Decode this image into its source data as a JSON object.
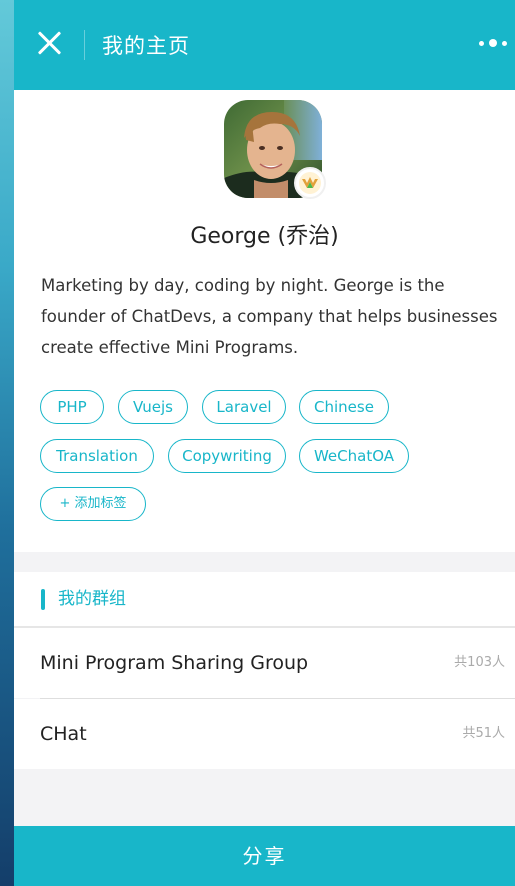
{
  "header": {
    "title": "我的主页",
    "close_icon": "close-icon",
    "more_icon": "more-dots-icon"
  },
  "profile": {
    "avatar_icon": "user-avatar",
    "badge_icon": "wechat-badge-icon",
    "name": "George (乔治)",
    "bio": "Marketing by day, coding by night. George is the founder of ChatDevs, a company that helps businesses create effective Mini Programs.",
    "tags": [
      "PHP",
      "Vuejs",
      "Laravel",
      "Chinese",
      "Translation",
      "Copywriting",
      "WeChatOA"
    ],
    "add_tag_label": "+ 添加标签"
  },
  "groups": {
    "section_title": "我的群组",
    "items": [
      {
        "name": "Mini Program Sharing Group",
        "count": "共103人"
      },
      {
        "name": "CHat",
        "count": "共51人"
      }
    ]
  },
  "footer": {
    "share_label": "分享"
  },
  "colors": {
    "accent": "#18b6c9",
    "background": "#f3f3f5"
  }
}
